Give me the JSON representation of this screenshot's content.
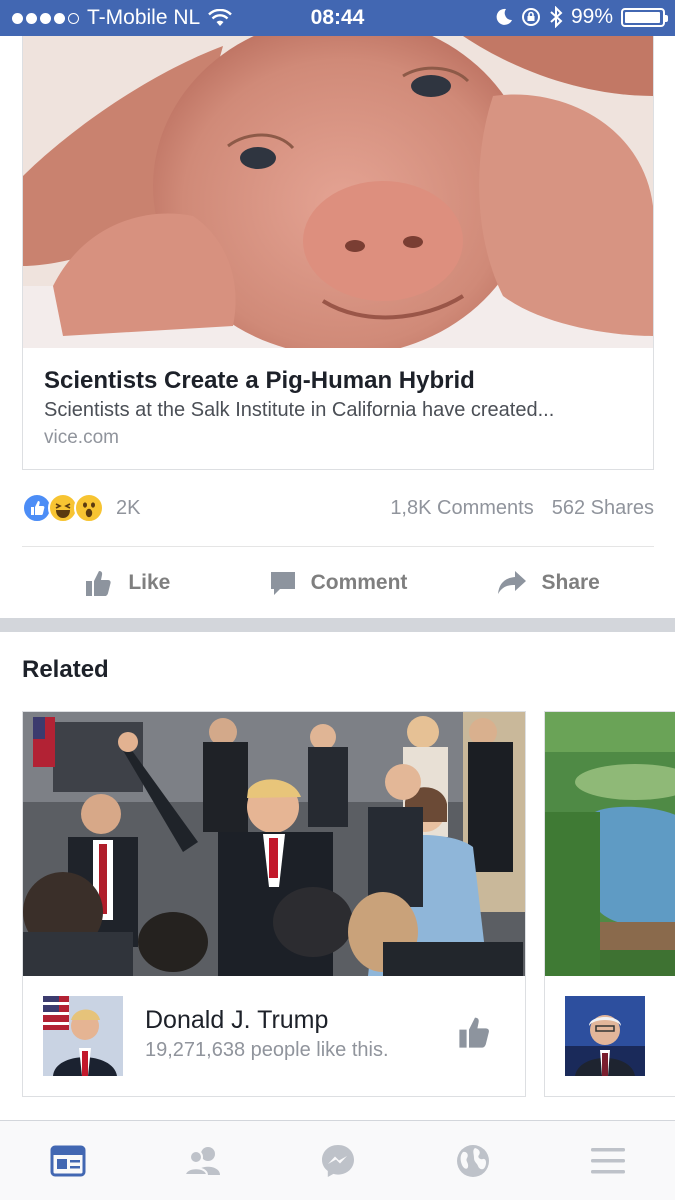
{
  "status_bar": {
    "carrier": "T-Mobile NL",
    "time": "08:44",
    "battery": "99%",
    "battery_level": 0.99
  },
  "post": {
    "link_title": "Scientists Create a Pig-Human Hybrid",
    "link_description": "Scientists at the Salk Institute in California have created...",
    "link_domain": "vice.com",
    "reactions_count": "2K",
    "comments_count": "1,8K Comments",
    "shares_count": "562 Shares",
    "reaction_icons": [
      "like-reaction-icon",
      "haha-reaction-icon",
      "wow-reaction-icon"
    ]
  },
  "actions": {
    "like_label": "Like",
    "comment_label": "Comment",
    "share_label": "Share"
  },
  "related": {
    "title": "Related",
    "items": [
      {
        "name": "Donald J. Trump",
        "likes": "19,271,638 people like this."
      }
    ]
  },
  "tab_bar": {
    "tabs": [
      "news-feed-icon",
      "friends-icon",
      "messenger-icon",
      "notifications-globe-icon",
      "menu-icon"
    ],
    "active_color": "#4267b2",
    "inactive_color": "#bec2c9"
  },
  "colors": {
    "brand": "#4267b2",
    "like_blue": "#4c8df6",
    "reaction_yellow": "#f7c432"
  }
}
